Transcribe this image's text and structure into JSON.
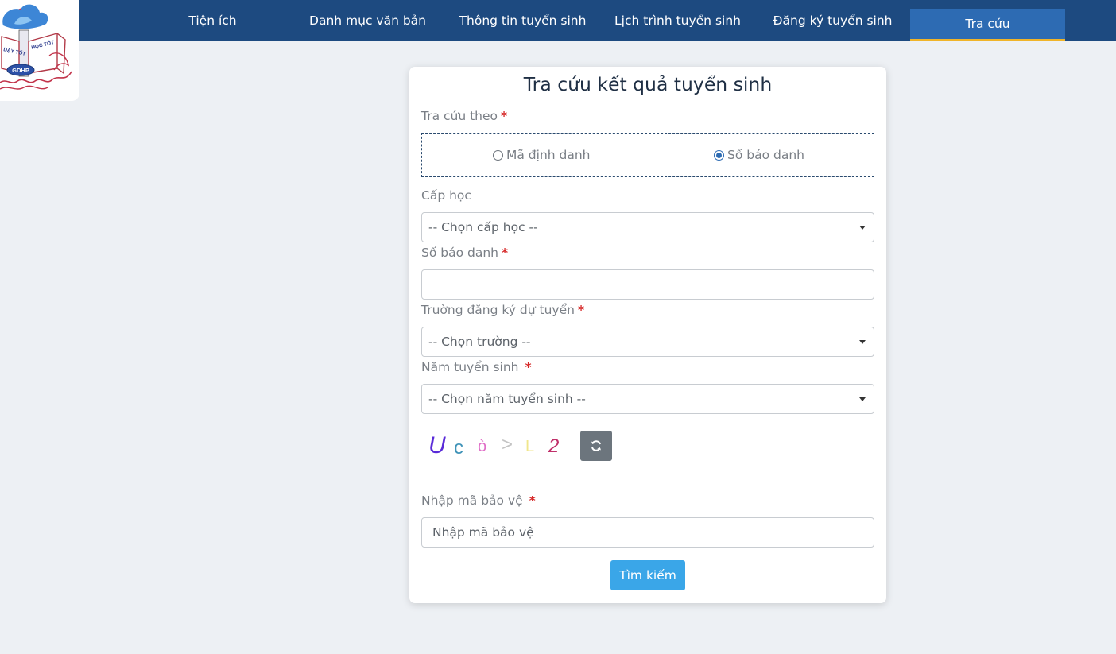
{
  "nav": {
    "items": [
      {
        "label": "Tiện ích"
      },
      {
        "label": "Danh mục văn bản"
      },
      {
        "label": "Thông tin tuyển sinh"
      },
      {
        "label": "Lịch trình tuyển sinh"
      },
      {
        "label": "Đăng ký tuyển sinh"
      },
      {
        "label": "Tra cứu"
      }
    ],
    "active_index": 5
  },
  "logo": {
    "text_left": "DẠY TỐT",
    "text_right": "HỌC TỐT",
    "text_badge": "GDHP"
  },
  "form": {
    "title": "Tra cứu kết quả tuyển sinh",
    "lookup_by": {
      "label": "Tra cứu theo",
      "required_mark": "*",
      "options": [
        {
          "label": "Mã định danh",
          "checked": false
        },
        {
          "label": "Số báo danh",
          "checked": true
        }
      ]
    },
    "level": {
      "label": "Cấp học",
      "selected": "-- Chọn cấp học --"
    },
    "candidate_number": {
      "label": "Số báo danh",
      "required_mark": "*",
      "value": ""
    },
    "school": {
      "label": "Trường đăng ký dự tuyển",
      "required_mark": "*",
      "selected": "-- Chọn trường --"
    },
    "year": {
      "label": "Năm tuyển sinh",
      "required_mark": "*",
      "selected": "-- Chọn năm tuyển sinh --"
    },
    "captcha": {
      "chars": [
        "U",
        "c",
        "ò",
        ">",
        "L",
        "2"
      ],
      "colors": [
        "#5a2bd8",
        "#3f93b8",
        "#e070c8",
        "#c4c4c4",
        "#f0e68c",
        "#c0306a"
      ]
    },
    "security_code": {
      "label": "Nhập mã bảo vệ",
      "required_mark": "*",
      "placeholder": "Nhập mã bảo vệ",
      "value": ""
    },
    "submit_label": "Tìm kiếm"
  },
  "colors": {
    "nav_bg": "#1d4a80",
    "nav_active_bg": "#2d6bb3",
    "nav_active_underline": "#f0b429",
    "page_bg": "#edf0f4",
    "submit_bg": "#3aa6e8",
    "required": "#d62828"
  }
}
